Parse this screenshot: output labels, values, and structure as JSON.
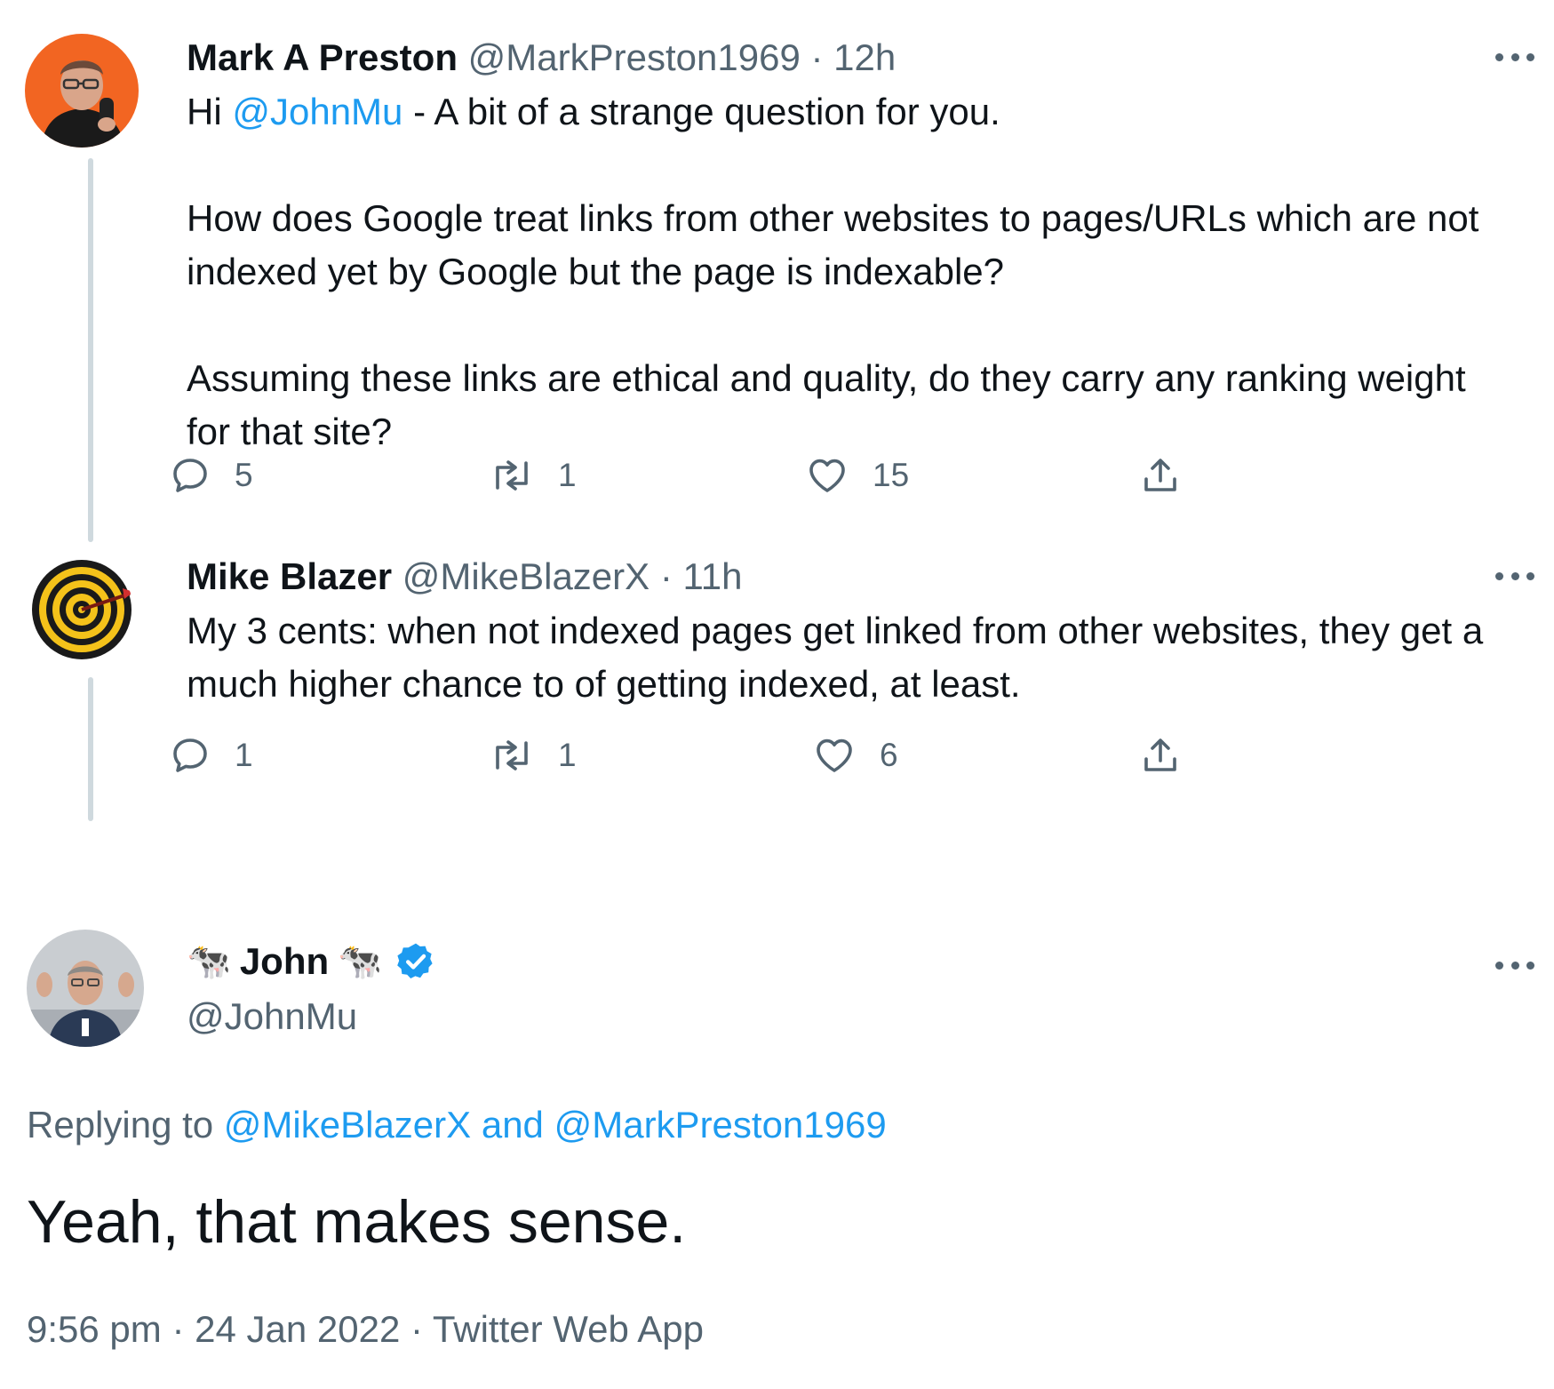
{
  "tweets": [
    {
      "name": "Mark A Preston",
      "handle": "@MarkPreston1969",
      "time": "12h",
      "body": {
        "p1_pre": "Hi ",
        "p1_mention": "@JohnMu",
        "p1_post": " - A bit of a strange question for you.",
        "p2": "How does Google treat links from other websites to pages/URLs which are not indexed yet by Google but the page is indexable?",
        "p3": "Assuming these links are ethical and quality, do they carry any ranking weight for that site?"
      },
      "replies": "5",
      "retweets": "1",
      "likes": "15"
    },
    {
      "name": "Mike Blazer",
      "handle": "@MikeBlazerX",
      "time": "11h",
      "body": "My 3 cents: when not indexed pages get linked from other websites, they get a much higher chance to of getting indexed, at least.",
      "replies": "1",
      "retweets": "1",
      "likes": "6"
    }
  ],
  "main": {
    "name": "John",
    "name_emoji": "🐄",
    "handle": "@JohnMu",
    "verified": true,
    "replying_label": "Replying to",
    "replying_users": "@MikeBlazerX and @MarkPreston1969",
    "text": "Yeah, that makes sense.",
    "time": "9:56 pm",
    "date": "24 Jan 2022",
    "source": "Twitter Web App",
    "separator": "·"
  },
  "colors": {
    "link": "#1d9bf0",
    "secondary": "#536471",
    "verified": "#1d9bf0"
  }
}
